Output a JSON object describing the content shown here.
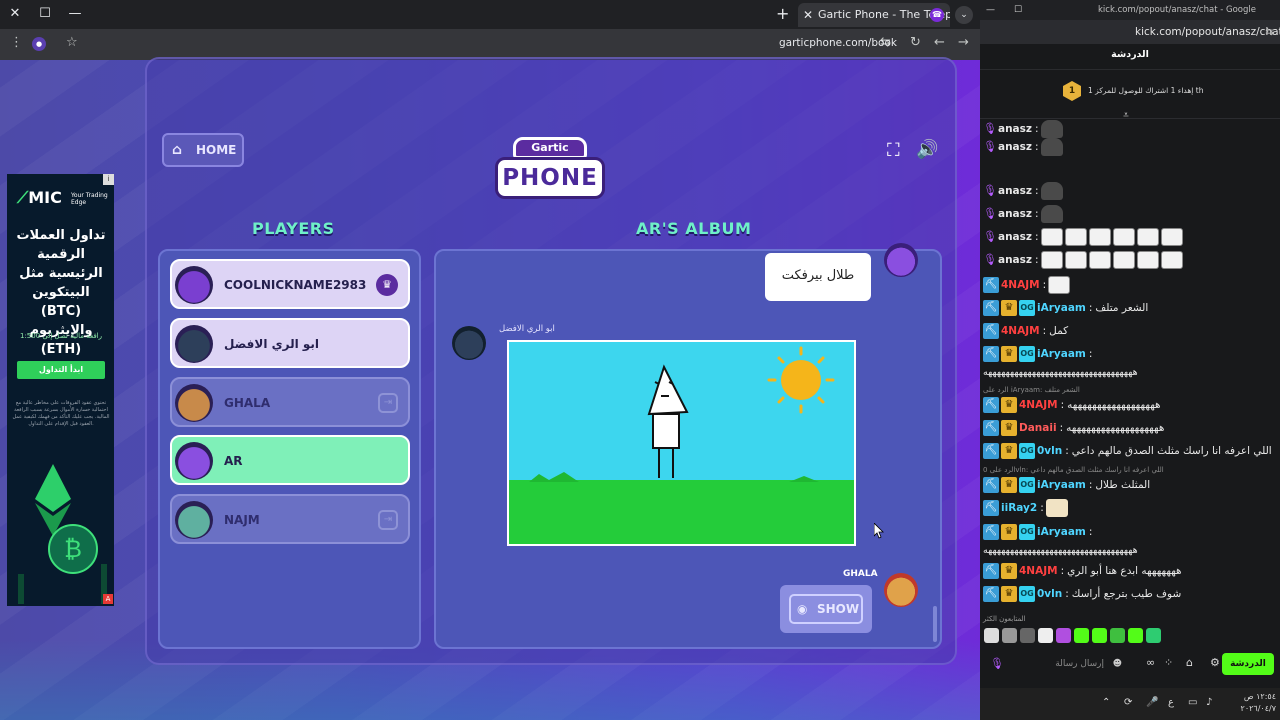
{
  "browser": {
    "tab_title": "Gartic Phone - The Telephone G",
    "url": "garticphone.com/book"
  },
  "game": {
    "home_label": "HOME",
    "logo_top": "Gartic",
    "logo_bottom": "PHONE",
    "players_title": "PLAYERS",
    "album_title": "AR'S ALBUM",
    "players": [
      {
        "name": "COOLNICKNAME2983",
        "style": "light",
        "badge": "crown",
        "avatar_color": "#7a3fd0"
      },
      {
        "name": "ابو الري الافضل",
        "style": "light",
        "badge": "",
        "avatar_color": "#2d3f5a"
      },
      {
        "name": "GHALA",
        "style": "dim",
        "badge": "leave",
        "avatar_color": "#c88a4a"
      },
      {
        "name": "AR",
        "style": "active",
        "badge": "",
        "avatar_color": "#8a4fe0"
      },
      {
        "name": "NAJM",
        "style": "dim",
        "badge": "leave",
        "avatar_color": "#5fb0a0"
      }
    ],
    "album": {
      "first_text": "طلال بيرفكت",
      "drawing_author": "ابو الري الافضل",
      "next_author": "GHALA",
      "show_label": "SHOW"
    }
  },
  "ad": {
    "brand": "MIC",
    "tagline": "Your Trading Edge",
    "headline": "تداول العملات الرقمية الرئيسية مثل البيتكوين (BTC) والإيثريوم (ETH)",
    "leverage": "رافعة مالية تصل إلى 1:500",
    "cta": "ابدأ التداول",
    "fine_print": "تحتوي عقود الفروقات على مخاطر عالية مع احتمالية خسارة الأموال بسرعة بسبب الرافعة المالية. يجب عليك التأكد من فهمك لكيفية عمل العقود قبل الإقدام على التداول."
  },
  "kick": {
    "window_title": "kick.com/popout/anasz/chat - Google Chrome",
    "url": "kick.com/popout/anasz/chat",
    "header": "الدردشة",
    "goal_number": "1",
    "goal_text": "إهداء 1 اشتراك للوصول للمركز 1 th",
    "messages": [
      {
        "user": "anasz",
        "color": "#e8e8e8",
        "badges": [
          "mic"
        ],
        "text": "",
        "emotes": [
          "hat"
        ]
      },
      {
        "user": "anasz",
        "color": "#e8e8e8",
        "badges": [
          "mic"
        ],
        "text": "",
        "emotes": [
          "hat"
        ]
      },
      {
        "user": "anasz",
        "color": "#e8e8e8",
        "badges": [
          "mic"
        ],
        "text": "",
        "emotes": [
          "hat"
        ]
      },
      {
        "user": "anasz",
        "color": "#e8e8e8",
        "badges": [
          "mic"
        ],
        "text": "",
        "emotes": [
          "hat"
        ]
      },
      {
        "user": "anasz",
        "color": "#e8e8e8",
        "badges": [
          "mic"
        ],
        "text": "",
        "emotes": [
          "face",
          "face",
          "face",
          "face",
          "face",
          "face"
        ]
      },
      {
        "user": "anasz",
        "color": "#e8e8e8",
        "badges": [
          "mic"
        ],
        "text": "",
        "emotes": [
          "face",
          "face",
          "face",
          "face",
          "face",
          "face"
        ]
      },
      {
        "user": "4NAJM",
        "color": "#ff4040",
        "badges": [
          "sub"
        ],
        "text": "",
        "emotes": [
          "face"
        ]
      },
      {
        "user": "iAryaam",
        "color": "#4fd5ff",
        "badges": [
          "sub",
          "crown",
          "og"
        ],
        "text": "الشعر متلف",
        "emotes": []
      },
      {
        "user": "4NAJM",
        "color": "#ff4040",
        "badges": [
          "sub"
        ],
        "text": "كمل",
        "emotes": []
      },
      {
        "user": "iAryaam",
        "color": "#4fd5ff",
        "badges": [
          "sub",
          "crown",
          "og"
        ],
        "text": "",
        "emotes": []
      }
    ],
    "long1": "ههههههههههههههههههههههههههههههههههه",
    "meta1": "الرد على iAryaam: الشعر متلف",
    "messages2": [
      {
        "user": "4NAJM",
        "color": "#ff4040",
        "badges": [
          "sub",
          "crown"
        ],
        "text": "ههههههههههههههههههه",
        "emotes": []
      },
      {
        "user": "Danaii",
        "color": "#ff5b5b",
        "badges": [
          "sub",
          "crown"
        ],
        "text": "هههههههههههههههههههه",
        "emotes": []
      },
      {
        "user": "0vln",
        "color": "#4fd5ff",
        "badges": [
          "sub",
          "crown",
          "og"
        ],
        "text": "اللي اعرفه انا راسك مثلث الصدق مالهم داعي",
        "emotes": []
      }
    ],
    "meta2": "الرد على 0vln: اللي اعرفه انا راسك مثلث الصدق مالهم داعي",
    "messages3": [
      {
        "user": "iAryaam",
        "color": "#4fd5ff",
        "badges": [
          "sub",
          "crown",
          "og"
        ],
        "text": "المثلث طلال",
        "emotes": []
      },
      {
        "user": "iiRay2",
        "color": "#4fd5ff",
        "badges": [
          "sub"
        ],
        "text": "",
        "emotes": [
          "anime"
        ]
      },
      {
        "user": "iAryaam",
        "color": "#4fd5ff",
        "badges": [
          "sub",
          "crown",
          "og"
        ],
        "text": "",
        "emotes": []
      }
    ],
    "long2": "ههههههههههههههههههههههههههههههههههه",
    "messages4": [
      {
        "user": "4NAJM",
        "color": "#ff4040",
        "badges": [
          "sub",
          "crown"
        ],
        "text": "هههههههه ابدع هنا أبو الري",
        "emotes": []
      },
      {
        "user": "0vln",
        "color": "#4fd5ff",
        "badges": [
          "sub",
          "crown",
          "og"
        ],
        "text": "شوف طيب بترجع أراسك",
        "emotes": []
      }
    ],
    "active_label": "المتابعون الكثر",
    "input_placeholder": "إرسال رسالة",
    "chat_button": "الدردشة",
    "clock_time": "١٢:٥٤ ص",
    "clock_date": "٢٠٢٦/٠٤/٧"
  }
}
